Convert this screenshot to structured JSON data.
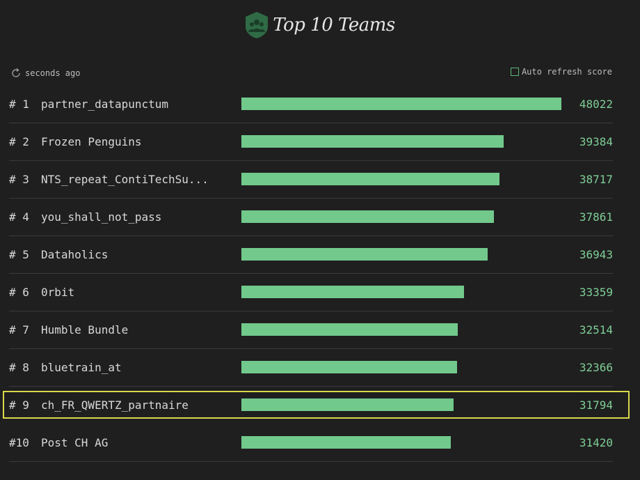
{
  "header": {
    "title": "Top 10 Teams",
    "accent_color": "#2f6b45"
  },
  "status": {
    "refresh_text": "seconds ago",
    "auto_refresh_label": "Auto refresh score",
    "auto_refresh_checked": false
  },
  "teams": [
    {
      "rank": "# 1",
      "name": "partner_datapunctum",
      "score": 48022
    },
    {
      "rank": "# 2",
      "name": "Frozen Penguins",
      "score": 39384
    },
    {
      "rank": "# 3",
      "name": "NTS_repeat_ContiTechSu...",
      "score": 38717
    },
    {
      "rank": "# 4",
      "name": "you_shall_not_pass",
      "score": 37861
    },
    {
      "rank": "# 5",
      "name": "Dataholics",
      "score": 36943
    },
    {
      "rank": "# 6",
      "name": "0rbit",
      "score": 33359
    },
    {
      "rank": "# 7",
      "name": "Humble Bundle",
      "score": 32514
    },
    {
      "rank": "# 8",
      "name": "bluetrain_at",
      "score": 32366
    },
    {
      "rank": "# 9",
      "name": "ch_FR_QWERTZ_partnaire",
      "score": 31794,
      "highlighted": true
    },
    {
      "rank": "#10",
      "name": "Post CH AG",
      "score": 31420
    }
  ]
}
